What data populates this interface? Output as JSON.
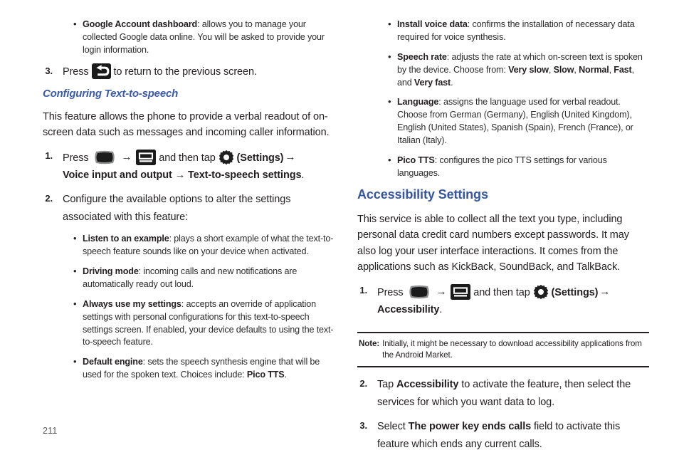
{
  "document": {
    "page_number": "211",
    "heading_color": "#3456a4",
    "text_color": "#231f20"
  },
  "left_column": {
    "top_bullets": [
      {
        "term": "Google Account dashboard",
        "text": ": allows you to manage your collected Google data online. You will be asked to provide your login information."
      }
    ],
    "step3": {
      "number": "3.",
      "before_icon": "Press",
      "icon": "back-key-icon",
      "after_icon": "to return to the previous screen."
    },
    "subheading": "Configuring Text-to-speech",
    "intro": "This feature allows the phone to provide a verbal readout of on-screen data such as messages and incoming caller information.",
    "step1": {
      "number": "1.",
      "press_label": "Press",
      "home_icon": "home-key-icon",
      "arrow1": "→",
      "menu_icon": "menu-key-icon",
      "middle_label": "and then tap",
      "gear_icon": "settings-gear-icon",
      "settings_label": "(Settings)",
      "arrow2": "→",
      "path": "Voice input and output → Text-to-speech settings",
      "period": "."
    },
    "step2": {
      "number": "2.",
      "text": "Configure the available options to alter the settings associated with this feature:"
    },
    "option_bullets": [
      {
        "term": "Listen to an example",
        "text": ": plays a short example of what the text-to-speech feature sounds like on your device when activated."
      },
      {
        "term": "Driving mode",
        "text": ": incoming calls and new notifications are automatically ready out loud."
      },
      {
        "term": "Always use my settings",
        "text": ": accepts an override of application settings with personal configurations for this text-to-speech settings screen. If enabled, your device defaults to using the text-to-speech feature."
      },
      {
        "term": "Default engine",
        "text_before": ": sets the speech synthesis engine that will be used for the spoken text. Choices include: ",
        "bold_tail": "Pico TTS",
        "text_after": "."
      }
    ]
  },
  "right_column": {
    "top_bullets": [
      {
        "term": "Install voice data",
        "text": ": confirms the installation of necessary data required for voice synthesis."
      },
      {
        "term": "Speech rate",
        "text_before": ": adjusts the rate at which on-screen text is spoken by the device. Choose from: ",
        "options": [
          "Very slow",
          "Slow",
          "Normal",
          "Fast",
          "Very fast"
        ],
        "text_after": "."
      },
      {
        "term": "Language",
        "text": ": assigns the language used for verbal readout. Choose from German (Germany), English (United Kingdom), English (United States), Spanish (Spain), French (France), or Italian (Italy)."
      },
      {
        "term": "Pico TTS",
        "text": ": configures the pico TTS settings for various languages."
      }
    ],
    "heading": "Accessibility Settings",
    "intro": "This service is able to collect all the text you type, including personal data credit card numbers except passwords. It may also log your user interface interactions. It comes from the applications such as KickBack, SoundBack, and TalkBack.",
    "step1": {
      "number": "1.",
      "press_label": "Press",
      "home_icon": "home-key-icon",
      "arrow1": "→",
      "menu_icon": "menu-key-icon",
      "middle_label": "and then tap",
      "gear_icon": "settings-gear-icon",
      "settings_label": "(Settings)",
      "arrow2": "→",
      "path": "Accessibility",
      "period": "."
    },
    "note": {
      "label": "Note:",
      "text": "Initially, it might be necessary to download accessibility applications from the Android Market."
    },
    "step2": {
      "number": "2.",
      "text_before": "Tap ",
      "bold": "Accessibility",
      "text_after": " to activate the feature, then select the services for which you want data to log."
    },
    "step3": {
      "number": "3.",
      "text_before": "Select ",
      "bold": "The power key ends calls",
      "text_after": " field to activate this feature which ends any current calls."
    }
  }
}
